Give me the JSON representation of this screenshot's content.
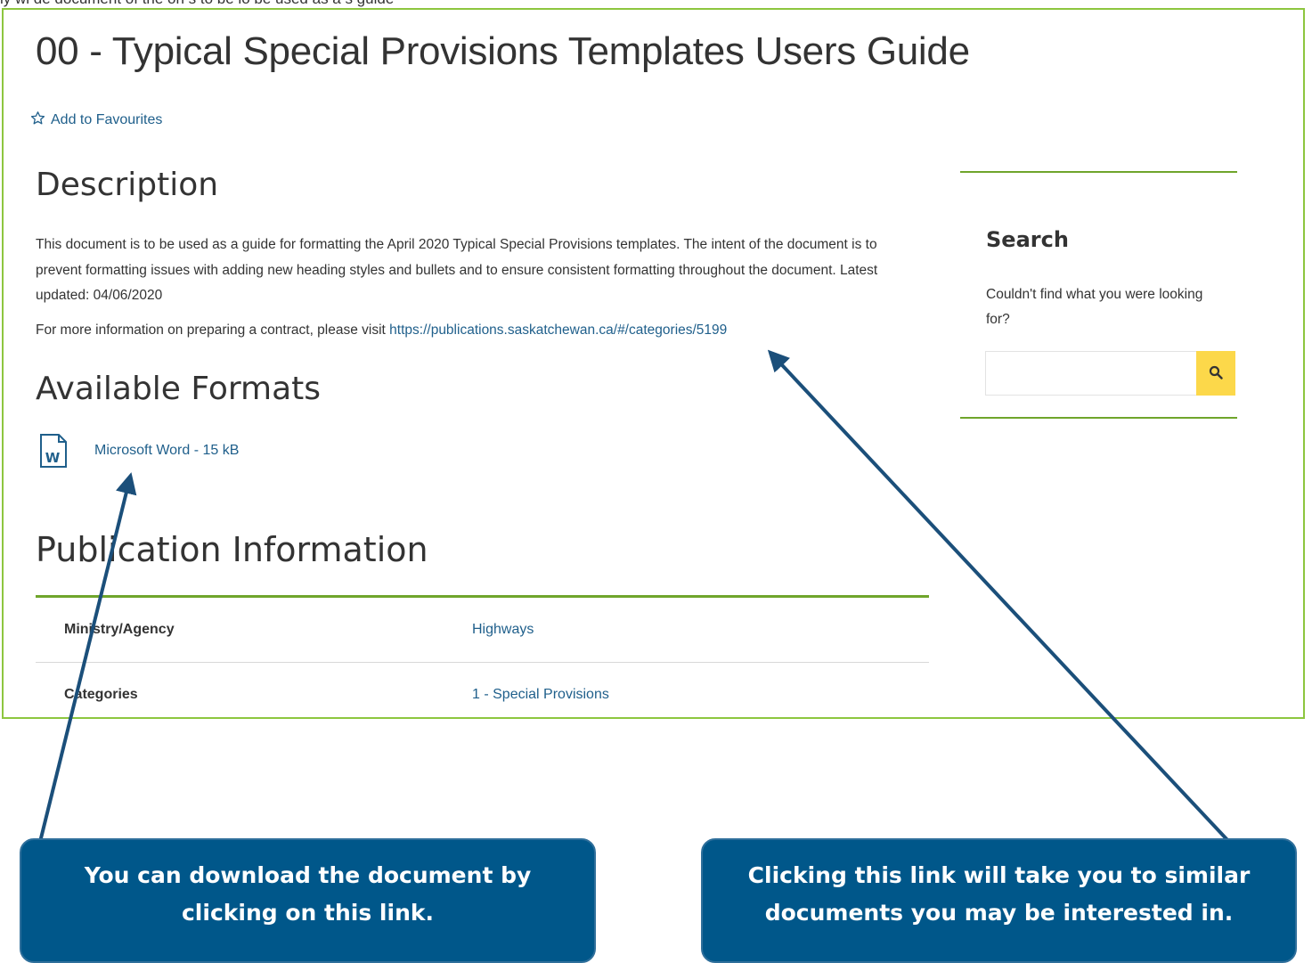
{
  "top_caption": "ly wi de document of the on s to be lo be used as a s guide",
  "page": {
    "title": "00 - Typical Special Provisions Templates Users Guide",
    "favourite_label": "Add to Favourites"
  },
  "description": {
    "heading": "Description",
    "body": "This document is to be used as a guide for formatting the April 2020 Typical Special Provisions templates.  The intent of the document is to prevent formatting issues with adding new heading styles and bullets and to ensure consistent formatting throughout the document. Latest updated: 04/06/2020",
    "more_prefix": "For more information on preparing a contract, please visit ",
    "more_link": "https://publications.saskatchewan.ca/#/categories/5199"
  },
  "formats": {
    "heading": "Available Formats",
    "items": [
      {
        "icon": "word-document-icon",
        "label": "Microsoft Word - 15 kB"
      }
    ]
  },
  "publication_info": {
    "heading": "Publication Information",
    "rows": [
      {
        "label": "Ministry/Agency",
        "value": "Highways"
      },
      {
        "label": "Categories",
        "value": "1 - Special Provisions"
      }
    ]
  },
  "sidebar": {
    "search_title": "Search",
    "search_prompt": "Couldn't find what you were looking for?",
    "search_value": "",
    "search_icon": "search-icon"
  },
  "callouts": {
    "left": "You can download the document by clicking on this link.",
    "right": "Clicking this link will take you to similar documents you may be interested in."
  },
  "colors": {
    "accent_green": "#6fa52b",
    "link_blue": "#1f5f8b",
    "callout_blue": "#00578a",
    "search_button": "#fcd84a"
  }
}
